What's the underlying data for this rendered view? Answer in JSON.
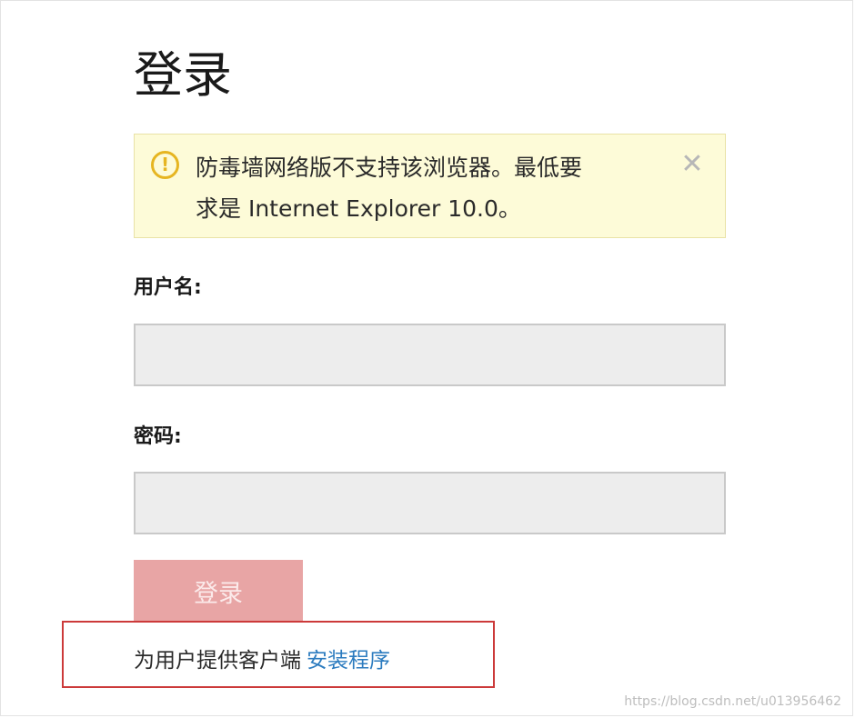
{
  "page": {
    "title": "登录"
  },
  "alert": {
    "icon": "warning-icon",
    "message_line1": "防毒墙网络版不支持该浏览器。最低要",
    "message_line2": "求是 Internet Explorer 10.0。",
    "close_icon": "close-icon"
  },
  "form": {
    "username_label": "用户名:",
    "username_value": "",
    "password_label": "密码:",
    "password_value": "",
    "login_button_label": "登录"
  },
  "client": {
    "text": "为用户提供客户端",
    "link_text": "安装程序"
  },
  "watermark": {
    "text": "https://blog.csdn.net/u013956462"
  },
  "colors": {
    "alert_background": "#fdfbd8",
    "alert_icon": "#e6b521",
    "login_button": "#e8a5a5",
    "link": "#2b7bbf",
    "highlight_border": "#cc3a3a"
  }
}
